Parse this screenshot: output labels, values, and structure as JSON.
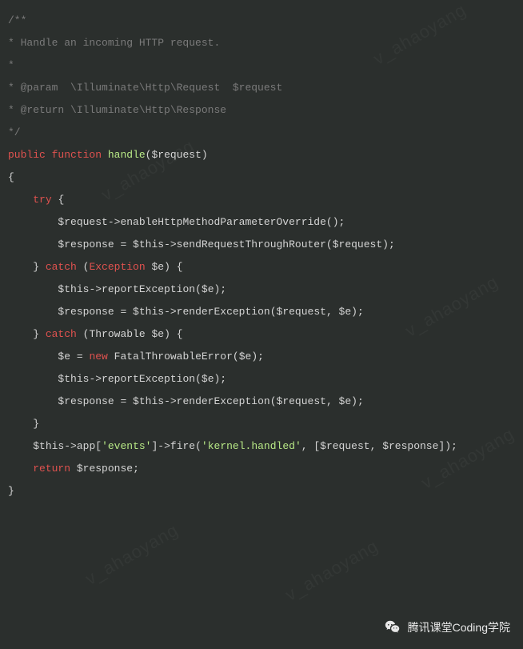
{
  "watermark": "v_ahaoyang",
  "footer": {
    "label": "腾讯课堂Coding学院"
  },
  "code": {
    "lines": [
      {
        "indent": 0,
        "tokens": [
          {
            "cls": "tok-comment",
            "t": "/**"
          }
        ]
      },
      {
        "indent": 0,
        "tokens": [
          {
            "cls": "tok-comment",
            "t": "* Handle an incoming HTTP request."
          }
        ]
      },
      {
        "indent": 0,
        "tokens": [
          {
            "cls": "tok-comment",
            "t": "*"
          }
        ]
      },
      {
        "indent": 0,
        "tokens": [
          {
            "cls": "tok-comment",
            "t": "* @param  \\Illuminate\\Http\\Request  $request"
          }
        ]
      },
      {
        "indent": 0,
        "tokens": [
          {
            "cls": "tok-comment",
            "t": "* @return \\Illuminate\\Http\\Response"
          }
        ]
      },
      {
        "indent": 0,
        "tokens": [
          {
            "cls": "tok-comment",
            "t": "*/"
          }
        ]
      },
      {
        "indent": 0,
        "tokens": [
          {
            "cls": "tok-keyword",
            "t": "public"
          },
          {
            "cls": "",
            "t": " "
          },
          {
            "cls": "tok-keyword",
            "t": "function"
          },
          {
            "cls": "",
            "t": " "
          },
          {
            "cls": "tok-funcname",
            "t": "handle"
          },
          {
            "cls": "tok-punct",
            "t": "("
          },
          {
            "cls": "tok-var",
            "t": "$request"
          },
          {
            "cls": "tok-punct",
            "t": ")"
          }
        ]
      },
      {
        "indent": 0,
        "tokens": [
          {
            "cls": "tok-punct",
            "t": "{"
          }
        ]
      },
      {
        "indent": 1,
        "tokens": [
          {
            "cls": "tok-keyword",
            "t": "try"
          },
          {
            "cls": "",
            "t": " "
          },
          {
            "cls": "tok-punct",
            "t": "{"
          }
        ]
      },
      {
        "indent": 2,
        "tokens": [
          {
            "cls": "tok-var",
            "t": "$request"
          },
          {
            "cls": "tok-punct",
            "t": "->"
          },
          {
            "cls": "tok-var",
            "t": "enableHttpMethodParameterOverride"
          },
          {
            "cls": "tok-punct",
            "t": "();"
          }
        ]
      },
      {
        "indent": 0,
        "tokens": [
          {
            "cls": "",
            "t": ""
          }
        ]
      },
      {
        "indent": 2,
        "tokens": [
          {
            "cls": "tok-var",
            "t": "$response"
          },
          {
            "cls": "tok-punct",
            "t": " = "
          },
          {
            "cls": "tok-var",
            "t": "$this"
          },
          {
            "cls": "tok-punct",
            "t": "->"
          },
          {
            "cls": "tok-var",
            "t": "sendRequestThroughRouter"
          },
          {
            "cls": "tok-punct",
            "t": "("
          },
          {
            "cls": "tok-var",
            "t": "$request"
          },
          {
            "cls": "tok-punct",
            "t": ");"
          }
        ]
      },
      {
        "indent": 1,
        "tokens": [
          {
            "cls": "tok-punct",
            "t": "} "
          },
          {
            "cls": "tok-keyword",
            "t": "catch"
          },
          {
            "cls": "tok-punct",
            "t": " ("
          },
          {
            "cls": "tok-type",
            "t": "Exception"
          },
          {
            "cls": "tok-punct",
            "t": " "
          },
          {
            "cls": "tok-var",
            "t": "$e"
          },
          {
            "cls": "tok-punct",
            "t": ") {"
          }
        ]
      },
      {
        "indent": 2,
        "tokens": [
          {
            "cls": "tok-var",
            "t": "$this"
          },
          {
            "cls": "tok-punct",
            "t": "->"
          },
          {
            "cls": "tok-var",
            "t": "reportException"
          },
          {
            "cls": "tok-punct",
            "t": "("
          },
          {
            "cls": "tok-var",
            "t": "$e"
          },
          {
            "cls": "tok-punct",
            "t": ");"
          }
        ]
      },
      {
        "indent": 0,
        "tokens": [
          {
            "cls": "",
            "t": ""
          }
        ]
      },
      {
        "indent": 2,
        "tokens": [
          {
            "cls": "tok-var",
            "t": "$response"
          },
          {
            "cls": "tok-punct",
            "t": " = "
          },
          {
            "cls": "tok-var",
            "t": "$this"
          },
          {
            "cls": "tok-punct",
            "t": "->"
          },
          {
            "cls": "tok-var",
            "t": "renderException"
          },
          {
            "cls": "tok-punct",
            "t": "("
          },
          {
            "cls": "tok-var",
            "t": "$request"
          },
          {
            "cls": "tok-punct",
            "t": ", "
          },
          {
            "cls": "tok-var",
            "t": "$e"
          },
          {
            "cls": "tok-punct",
            "t": ");"
          }
        ]
      },
      {
        "indent": 1,
        "tokens": [
          {
            "cls": "tok-punct",
            "t": "} "
          },
          {
            "cls": "tok-keyword",
            "t": "catch"
          },
          {
            "cls": "tok-punct",
            "t": " ("
          },
          {
            "cls": "tok-type2",
            "t": "Throwable"
          },
          {
            "cls": "tok-punct",
            "t": " "
          },
          {
            "cls": "tok-var",
            "t": "$e"
          },
          {
            "cls": "tok-punct",
            "t": ") {"
          }
        ]
      },
      {
        "indent": 2,
        "tokens": [
          {
            "cls": "tok-var",
            "t": "$e"
          },
          {
            "cls": "tok-punct",
            "t": " = "
          },
          {
            "cls": "tok-new",
            "t": "new"
          },
          {
            "cls": "tok-punct",
            "t": " "
          },
          {
            "cls": "tok-var",
            "t": "FatalThrowableError"
          },
          {
            "cls": "tok-punct",
            "t": "("
          },
          {
            "cls": "tok-var",
            "t": "$e"
          },
          {
            "cls": "tok-punct",
            "t": ");"
          }
        ]
      },
      {
        "indent": 0,
        "tokens": [
          {
            "cls": "",
            "t": ""
          }
        ]
      },
      {
        "indent": 2,
        "tokens": [
          {
            "cls": "tok-var",
            "t": "$this"
          },
          {
            "cls": "tok-punct",
            "t": "->"
          },
          {
            "cls": "tok-var",
            "t": "reportException"
          },
          {
            "cls": "tok-punct",
            "t": "("
          },
          {
            "cls": "tok-var",
            "t": "$e"
          },
          {
            "cls": "tok-punct",
            "t": ");"
          }
        ]
      },
      {
        "indent": 0,
        "tokens": [
          {
            "cls": "",
            "t": ""
          }
        ]
      },
      {
        "indent": 2,
        "tokens": [
          {
            "cls": "tok-var",
            "t": "$response"
          },
          {
            "cls": "tok-punct",
            "t": " = "
          },
          {
            "cls": "tok-var",
            "t": "$this"
          },
          {
            "cls": "tok-punct",
            "t": "->"
          },
          {
            "cls": "tok-var",
            "t": "renderException"
          },
          {
            "cls": "tok-punct",
            "t": "("
          },
          {
            "cls": "tok-var",
            "t": "$request"
          },
          {
            "cls": "tok-punct",
            "t": ", "
          },
          {
            "cls": "tok-var",
            "t": "$e"
          },
          {
            "cls": "tok-punct",
            "t": ");"
          }
        ]
      },
      {
        "indent": 1,
        "tokens": [
          {
            "cls": "tok-punct",
            "t": "}"
          }
        ]
      },
      {
        "indent": 0,
        "tokens": [
          {
            "cls": "",
            "t": ""
          }
        ]
      },
      {
        "indent": 1,
        "tokens": [
          {
            "cls": "tok-var",
            "t": "$this"
          },
          {
            "cls": "tok-punct",
            "t": "->"
          },
          {
            "cls": "tok-var",
            "t": "app"
          },
          {
            "cls": "tok-punct",
            "t": "["
          },
          {
            "cls": "tok-string",
            "t": "'events'"
          },
          {
            "cls": "tok-punct",
            "t": "]->"
          },
          {
            "cls": "tok-var",
            "t": "fire"
          },
          {
            "cls": "tok-punct",
            "t": "("
          },
          {
            "cls": "tok-string",
            "t": "'kernel.handled'"
          },
          {
            "cls": "tok-punct",
            "t": ", ["
          },
          {
            "cls": "tok-var",
            "t": "$request"
          },
          {
            "cls": "tok-punct",
            "t": ", "
          },
          {
            "cls": "tok-var",
            "t": "$response"
          },
          {
            "cls": "tok-punct",
            "t": "]);"
          }
        ]
      },
      {
        "indent": 0,
        "tokens": [
          {
            "cls": "",
            "t": ""
          }
        ]
      },
      {
        "indent": 1,
        "tokens": [
          {
            "cls": "tok-keyword",
            "t": "return"
          },
          {
            "cls": "tok-punct",
            "t": " "
          },
          {
            "cls": "tok-var",
            "t": "$response"
          },
          {
            "cls": "tok-punct",
            "t": ";"
          }
        ]
      },
      {
        "indent": 0,
        "tokens": [
          {
            "cls": "tok-punct",
            "t": "}"
          }
        ]
      }
    ]
  }
}
